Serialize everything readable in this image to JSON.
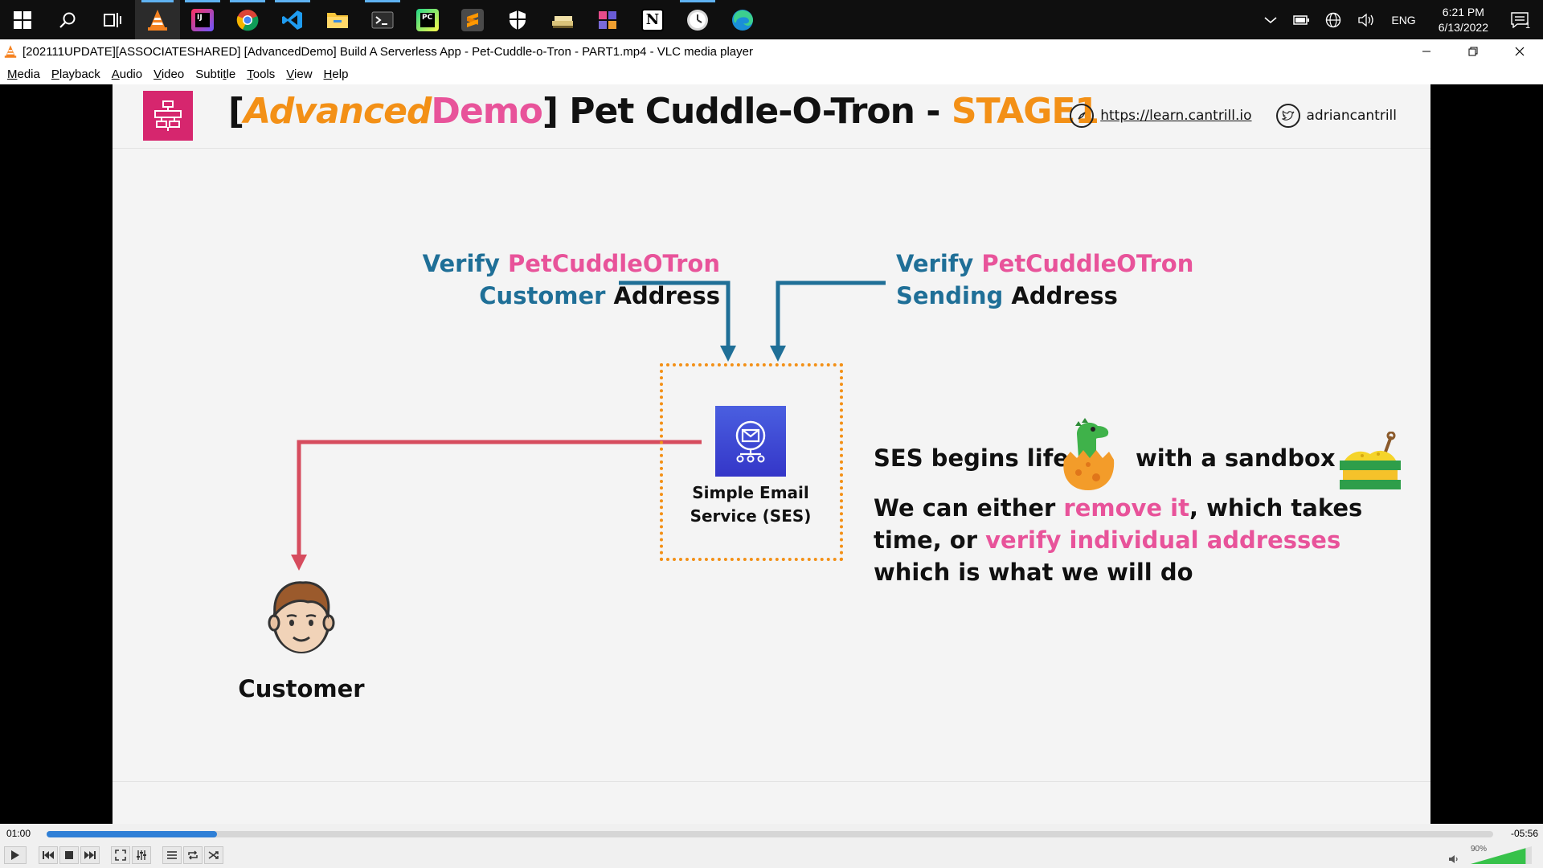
{
  "taskbar": {
    "clock_time": "6:21 PM",
    "clock_date": "6/13/2022",
    "language": "ENG",
    "notifications_count": "1",
    "apps": [
      "start",
      "search",
      "task-view",
      "vlc",
      "intellij",
      "chrome",
      "vscode",
      "file-explorer",
      "terminal",
      "pycharm",
      "sublime",
      "security",
      "app-a",
      "app-b",
      "notion",
      "clock-app",
      "edge"
    ]
  },
  "window": {
    "title": "[202111UPDATE][ASSOCIATESHARED] [AdvancedDemo] Build A Serverless App - Pet-Cuddle-o-Tron - PART1.mp4 - VLC media player"
  },
  "menu": {
    "items": [
      {
        "label": "Media",
        "accel": "M",
        "rest": "edia"
      },
      {
        "label": "Playback",
        "accel": "P",
        "rest": "layback"
      },
      {
        "label": "Audio",
        "accel": "A",
        "rest": "udio"
      },
      {
        "label": "Video",
        "accel": "V",
        "rest": "ideo"
      },
      {
        "label": "Subtitle",
        "pre": "Subti",
        "accel": "t",
        "rest": "le"
      },
      {
        "label": "Tools",
        "accel": "T",
        "rest": "ools"
      },
      {
        "label": "View",
        "accel": "V",
        "rest": "iew"
      },
      {
        "label": "Help",
        "accel": "H",
        "rest": "elp"
      }
    ]
  },
  "slide": {
    "title": {
      "bracket_open": "[",
      "advanced": "Advanced",
      "demo": "Demo",
      "bracket_close": "]",
      "main": " Pet Cuddle-O-Tron - ",
      "stage": "STAGE1"
    },
    "website": "https://learn.cantrill.io",
    "twitter": "adriancantrill",
    "verify_left": {
      "line1_a": "Verify ",
      "line1_b": "PetCuddleOTron",
      "line2_a": "Customer ",
      "line2_b": "Address"
    },
    "verify_right": {
      "line1_a": "Verify ",
      "line1_b": "PetCuddleOTron",
      "line2_a": "Sending ",
      "line2_b": "Address"
    },
    "ses_label_line1": "Simple Email",
    "ses_label_line2": "Service (SES)",
    "customer_label": "Customer",
    "sandbox": {
      "part1": "SES begins life",
      "part2": "with a sandbox"
    },
    "note": {
      "l1_a": "We can either ",
      "l1_b": "remove it",
      "l1_c": ", which takes",
      "l2_a": "time, or ",
      "l2_b": "verify individual addresses",
      "l3": "which is what we will do"
    }
  },
  "player": {
    "time_elapsed": "01:00",
    "time_remaining": "-05:56",
    "progress": 0.118,
    "volume_label": "90%",
    "volume": 0.9
  },
  "colors": {
    "accent_orange": "#f39016",
    "accent_pink": "#e8539a",
    "blue_text": "#1f6f97",
    "arrow_blue": "#1f6f97",
    "arrow_red": "#d64c5e",
    "ses_icon": "#3436c8",
    "seek_fill": "#2f7fd6"
  }
}
